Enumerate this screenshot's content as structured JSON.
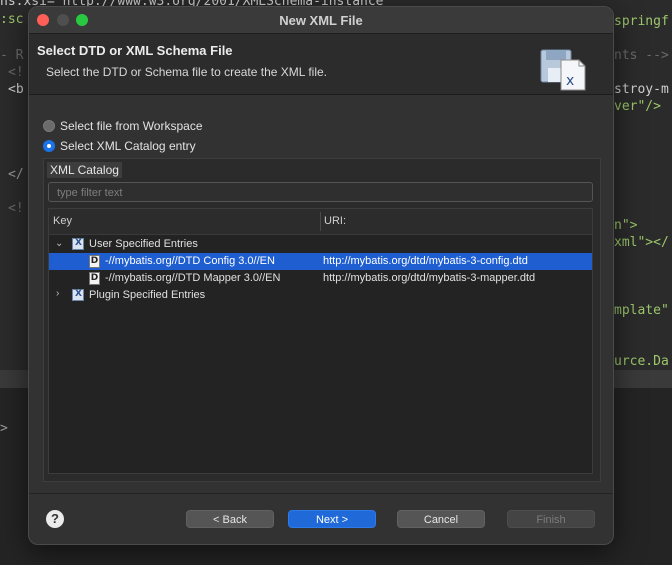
{
  "editor": {
    "lines": [
      {
        "text": "ns:xsi=\"http://www.w3.org/2001/XMLSchema-instance\"",
        "color": "#cfcfcf"
      },
      {
        "text": ":sc",
        "color": "#9cc76b"
      },
      {
        "text": "springf",
        "color": "#9cc76b"
      },
      {
        "text": "- R",
        "color": "#6b6b6b"
      },
      {
        "text": "nts -->",
        "color": "#6b6b6b"
      },
      {
        "text": "<!",
        "color": "#6b6b6b"
      },
      {
        "text": "<b",
        "color": "#cfcfcf"
      },
      {
        "text": "stroy-m",
        "color": "#cfcfcf"
      },
      {
        "text": "ver\"/>",
        "color": "#9cc76b"
      },
      {
        "text": "</",
        "color": "#9a9a9a"
      },
      {
        "text": "<!",
        "color": "#6b6b6b"
      },
      {
        "text": "n\">",
        "color": "#9cc76b"
      },
      {
        "text": "xml\"></",
        "color": "#9cc76b"
      },
      {
        "text": "mplate\"",
        "color": "#9cc76b"
      },
      {
        "text": "urce.Da",
        "color": "#9cc76b"
      },
      {
        "text": ">",
        "color": "#9a9a9a"
      }
    ]
  },
  "dialog": {
    "title": "New XML File",
    "header_title": "Select DTD or XML Schema File",
    "header_desc": "Select the DTD or Schema file to create the XML file.",
    "radio_workspace": "Select file from Workspace",
    "radio_catalog": "Select XML Catalog entry",
    "group_label": "XML Catalog",
    "filter_placeholder": "type filter text",
    "col_key": "Key",
    "col_uri": "URI:",
    "tree": {
      "user_entries": "User Specified Entries",
      "entries": [
        {
          "key": "-//mybatis.org//DTD Config 3.0//EN",
          "uri": "http://mybatis.org/dtd/mybatis-3-config.dtd",
          "icon_letter": "D",
          "selected": true
        },
        {
          "key": "-//mybatis.org//DTD Mapper 3.0//EN",
          "uri": "http://mybatis.org/dtd/mybatis-3-mapper.dtd",
          "icon_letter": "D",
          "selected": false
        }
      ],
      "plugin_entries": "Plugin Specified Entries"
    },
    "buttons": {
      "help": "?",
      "back": "< Back",
      "next": "Next >",
      "cancel": "Cancel",
      "finish": "Finish"
    }
  }
}
